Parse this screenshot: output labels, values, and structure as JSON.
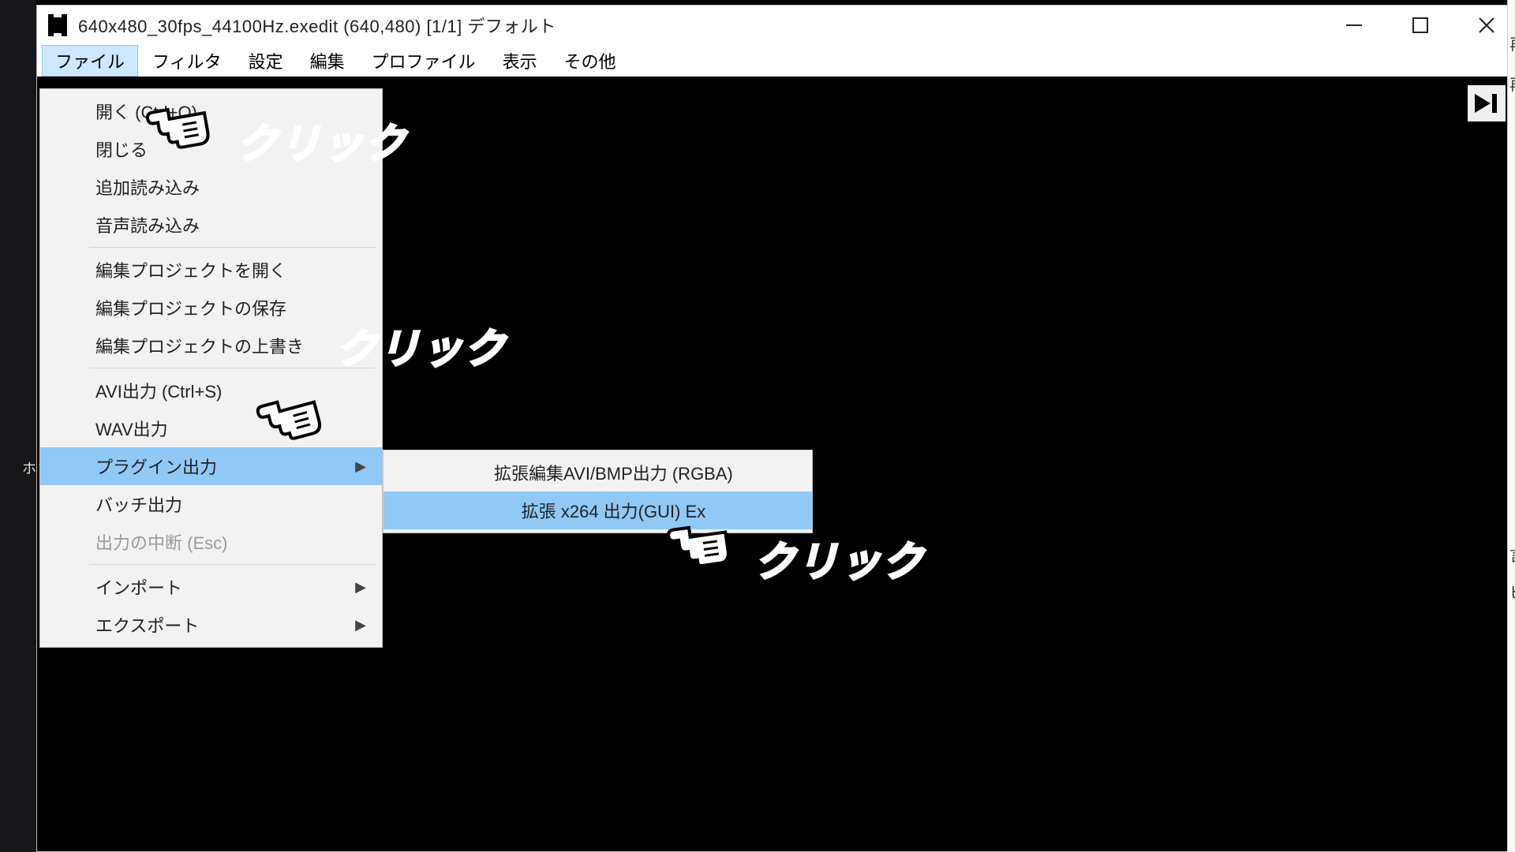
{
  "title": "640x480_30fps_44100Hz.exedit (640,480)  [1/1]  デフォルト",
  "menubar": [
    "ファイル",
    "フィルタ",
    "設定",
    "編集",
    "プロファイル",
    "表示",
    "その他"
  ],
  "file_menu": {
    "open": "開く (Ctrl+O)",
    "close": "閉じる",
    "append": "追加読み込み",
    "audio": "音声読み込み",
    "proj_open": "編集プロジェクトを開く",
    "proj_save": "編集プロジェクトの保存",
    "proj_over": "編集プロジェクトの上書き",
    "avi_out": "AVI出力 (Ctrl+S)",
    "wav_out": "WAV出力",
    "plugin_out": "プラグイン出力",
    "batch_out": "バッチ出力",
    "cancel_out": "出力の中断 (Esc)",
    "import": "インポート",
    "export": "エクスポート"
  },
  "plugin_sub": {
    "avi_bmp": "拡張編集AVI/BMP出力 (RGBA)",
    "x264": "拡張 x264 出力(GUI) Ex"
  },
  "annot": {
    "click": "クリック"
  },
  "sliver": {
    "a": "再",
    "b": "再",
    "c": "言",
    "d": "ピ"
  }
}
